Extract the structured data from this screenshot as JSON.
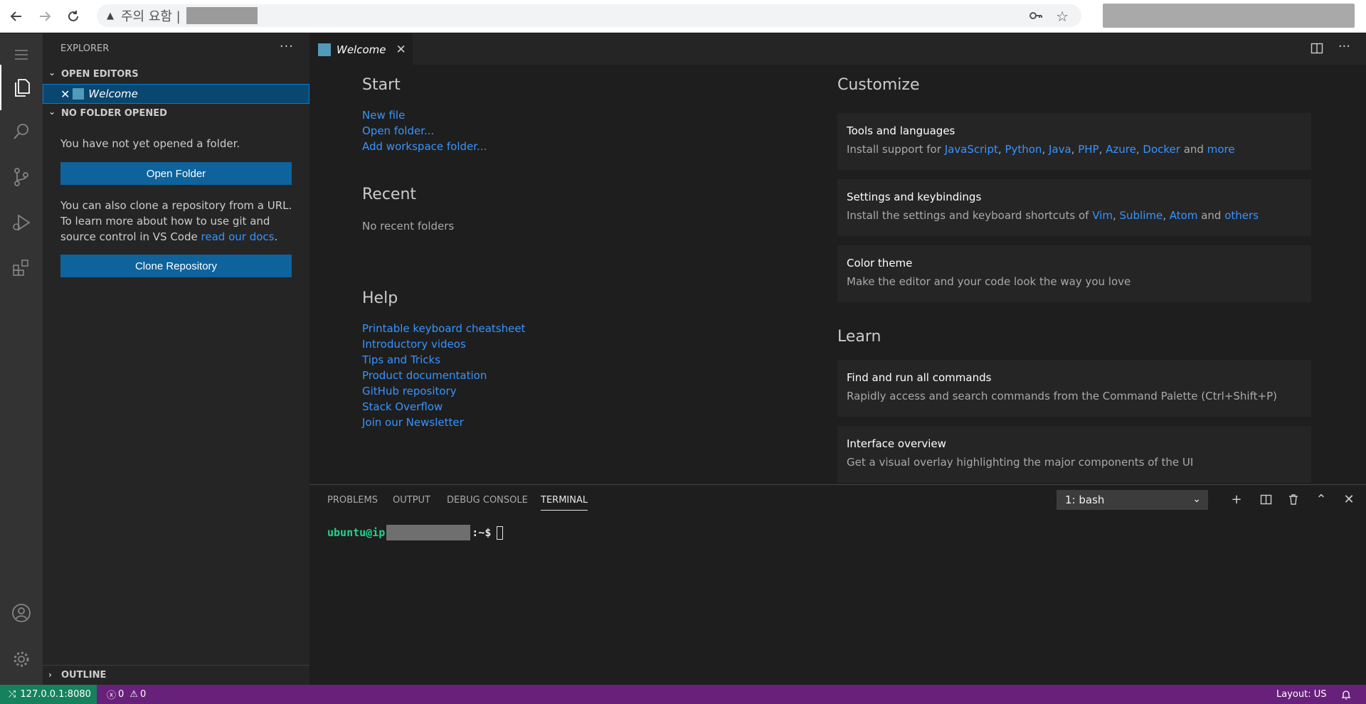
{
  "browser": {
    "security_text": "주의 요함 |",
    "nav": {
      "back": "back-icon",
      "forward": "forward-icon",
      "reload": "reload-icon"
    }
  },
  "activity_bar": {
    "items": [
      "menu-icon",
      "files-icon",
      "search-icon",
      "source-control-icon",
      "run-debug-icon",
      "extensions-icon",
      "account-icon",
      "settings-gear-icon"
    ]
  },
  "sidebar": {
    "title": "EXPLORER",
    "more": "···",
    "open_editors_label": "OPEN EDITORS",
    "open_editor_item": "Welcome",
    "no_folder_label": "NO FOLDER OPENED",
    "not_opened_text": "You have not yet opened a folder.",
    "open_folder_button": "Open Folder",
    "clone_text_1": "You can also clone a repository from a URL.",
    "clone_text_2": "To learn more about how to use git and",
    "clone_text_3": "source control in VS Code",
    "clone_link": "read our docs",
    "clone_period": ".",
    "clone_button": "Clone Repository",
    "outline_label": "OUTLINE"
  },
  "editor": {
    "tab_label": "Welcome",
    "welcome": {
      "start": {
        "heading": "Start",
        "links": [
          "New file",
          "Open folder...",
          "Add workspace folder..."
        ]
      },
      "recent": {
        "heading": "Recent",
        "empty": "No recent folders"
      },
      "help": {
        "heading": "Help",
        "links": [
          "Printable keyboard cheatsheet",
          "Introductory videos",
          "Tips and Tricks",
          "Product documentation",
          "GitHub repository",
          "Stack Overflow",
          "Join our Newsletter"
        ]
      },
      "customize": {
        "heading": "Customize",
        "cards": [
          {
            "title": "Tools and languages",
            "prefix": "Install support for ",
            "links": [
              "JavaScript",
              "Python",
              "Java",
              "PHP",
              "Azure",
              "Docker"
            ],
            "and": "and",
            "last": "more"
          },
          {
            "title": "Settings and keybindings",
            "prefix": "Install the settings and keyboard shortcuts of ",
            "links": [
              "Vim",
              "Sublime",
              "Atom"
            ],
            "and": "and",
            "last": "others"
          },
          {
            "title": "Color theme",
            "desc": "Make the editor and your code look the way you love"
          }
        ]
      },
      "learn": {
        "heading": "Learn",
        "cards": [
          {
            "title": "Find and run all commands",
            "desc": "Rapidly access and search commands from the Command Palette (Ctrl+Shift+P)"
          },
          {
            "title": "Interface overview",
            "desc": "Get a visual overlay highlighting the major components of the UI"
          }
        ]
      }
    }
  },
  "panel": {
    "tabs": [
      "PROBLEMS",
      "OUTPUT",
      "DEBUG CONSOLE",
      "TERMINAL"
    ],
    "active_tab": "TERMINAL",
    "terminal_select": "1: bash",
    "prompt_user": "ubuntu@ip",
    "prompt_suffix": ":~$"
  },
  "statusbar": {
    "remote": "127.0.0.1:8080",
    "errors": "0",
    "warnings": "0",
    "layout": "Layout: US"
  },
  "colors": {
    "statusbar_bg": "#68217a",
    "remote_bg": "#16825d",
    "button_bg": "#0e639c",
    "link": "#3794ff"
  }
}
